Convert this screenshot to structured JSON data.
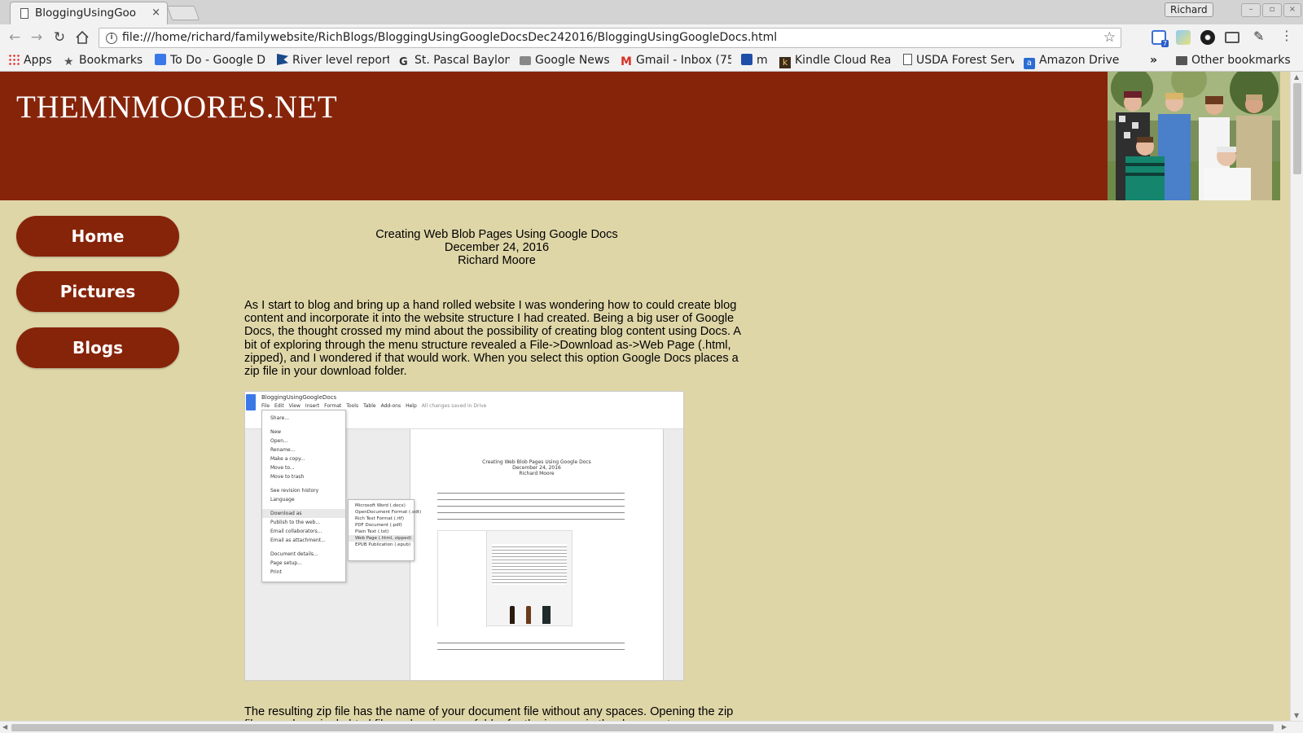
{
  "browser": {
    "tab_title": "BloggingUsingGoo",
    "tab_close": "×",
    "profile_name": "Richard",
    "url": "file:///home/richard/familywebsite/RichBlogs/BloggingUsingGoogleDocsDec242016/BloggingUsingGoogleDocs.html",
    "extension_badge": "7",
    "window_buttons": [
      "–",
      "▫",
      "×"
    ],
    "nav_icons": [
      "back-icon",
      "forward-icon",
      "reload-icon",
      "home-icon"
    ]
  },
  "bookmarks": {
    "items": [
      {
        "label": "Apps",
        "icon": "apps-grid-icon"
      },
      {
        "label": "Bookmarks",
        "icon": "star-icon"
      },
      {
        "label": "To Do - Google D",
        "icon": "google-docs-icon"
      },
      {
        "label": "River level report",
        "icon": "flag-icon"
      },
      {
        "label": "St. Pascal Baylon",
        "icon": "google-g-icon"
      },
      {
        "label": "Google News",
        "icon": "news-icon"
      },
      {
        "label": "Gmail - Inbox (75",
        "icon": "gmail-icon"
      },
      {
        "label": "m",
        "icon": "chat-icon"
      },
      {
        "label": "Kindle Cloud Rea",
        "icon": "kindle-icon"
      },
      {
        "label": "USDA Forest Serv",
        "icon": "page-icon"
      },
      {
        "label": "Amazon Drive",
        "icon": "amazon-icon"
      }
    ],
    "overflow": "»",
    "other": "Other bookmarks"
  },
  "site": {
    "title": "THEMNMOORES.NET",
    "nav": [
      "Home",
      "Pictures",
      "Blogs"
    ]
  },
  "article": {
    "title": "Creating Web Blob Pages Using Google Docs",
    "date": "December 24, 2016",
    "author": "Richard Moore",
    "intro": "As I start to blog and bring up a hand rolled website I was wondering how to could create blog content and incorporate it into the website structure I had created. Being a big user of Google Docs, the thought crossed my mind about the possibility of creating blog content using Docs. A bit of exploring through the menu structure revealed a File->Download as->Web Page (.html, zipped), and I wondered if that would work. When you select this option Google Docs places a zip file in your download folder.",
    "after": "The resulting zip file has the name of your document file without any spaces. Opening the zip file reveals a single html file and an images folder for the images in the document."
  },
  "screenshot": {
    "doc_title": "BloggingUsingGoogleDocs",
    "menus": [
      "File",
      "Edit",
      "View",
      "Insert",
      "Format",
      "Tools",
      "Table",
      "Add-ons",
      "Help"
    ],
    "saved_status": "All changes saved in Drive",
    "file_menu": [
      "Share...",
      "New",
      "Open...",
      "Rename...",
      "Make a copy...",
      "Move to...",
      "Move to trash",
      "See revision history",
      "Language",
      "Download as",
      "Publish to the web...",
      "Email collaborators...",
      "Email as attachment...",
      "Document details...",
      "Page setup...",
      "Print"
    ],
    "download_menu": [
      "Microsoft Word (.docx)",
      "OpenDocument Format (.odt)",
      "Rich Text Format (.rtf)",
      "PDF Document (.pdf)",
      "Plain Text (.txt)",
      "Web Page (.html, zipped)",
      "EPUB Publication (.epub)"
    ],
    "doc_heading": [
      "Creating Web Blob Pages Using Google Docs",
      "December 24, 2016",
      "Richard Moore"
    ]
  }
}
